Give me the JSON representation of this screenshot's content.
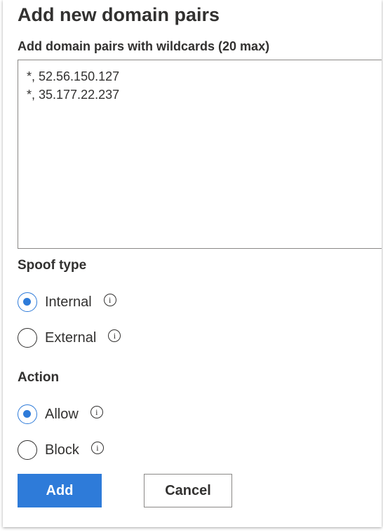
{
  "panel": {
    "title": "Add new domain pairs",
    "field_label": "Add domain pairs with wildcards (20 max)",
    "domain_pairs": [
      "*, 52.56.150.127",
      "*, 35.177.22.237"
    ]
  },
  "spoof_type": {
    "label": "Spoof type",
    "options": [
      {
        "label": "Internal",
        "checked": true
      },
      {
        "label": "External",
        "checked": false
      }
    ]
  },
  "action": {
    "label": "Action",
    "options": [
      {
        "label": "Allow",
        "checked": true
      },
      {
        "label": "Block",
        "checked": false
      }
    ]
  },
  "buttons": {
    "add_label": "Add",
    "cancel_label": "Cancel"
  },
  "colors": {
    "accent": "#2e7bd9",
    "text": "#323130",
    "border": "#8a8886"
  },
  "icons": {
    "info": "info-icon",
    "info_glyph": "i"
  }
}
